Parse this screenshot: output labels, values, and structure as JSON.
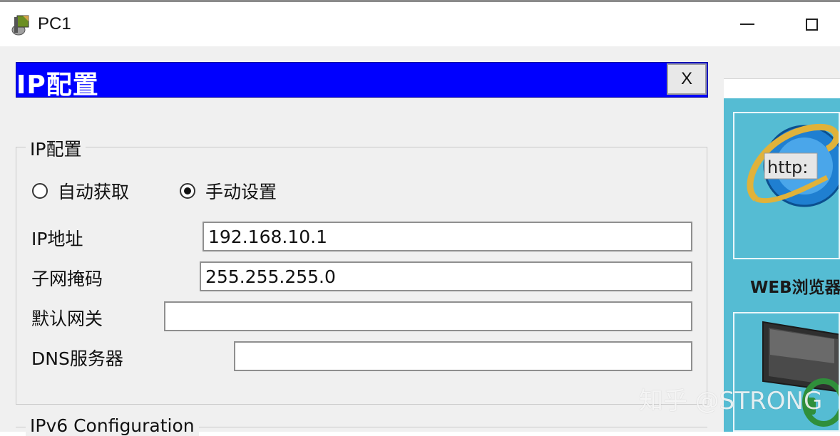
{
  "window": {
    "title": "PC1",
    "icon": "packet-tracer-pc-icon"
  },
  "dialog": {
    "title": "IP配置",
    "close_label": "X"
  },
  "ip_config": {
    "legend": "IP配置",
    "radio_auto": {
      "label": "自动获取",
      "selected": false
    },
    "radio_manual": {
      "label": "手动设置",
      "selected": true
    },
    "fields": {
      "ip_label": "IP地址",
      "ip_value": "192.168.10.1",
      "mask_label": "子网掩码",
      "mask_value": "255.255.255.0",
      "gateway_label": "默认网关",
      "gateway_value": "",
      "dns_label": "DNS服务器",
      "dns_value": ""
    }
  },
  "ipv6": {
    "legend": "IPv6 Configuration"
  },
  "desktop": {
    "web_icon_text": "http:",
    "web_label": "WEB浏览器"
  },
  "watermark": "知乎 @STRONG",
  "colors": {
    "dialog_header": "#0000ff",
    "desktop_bg": "#55bcd3"
  }
}
